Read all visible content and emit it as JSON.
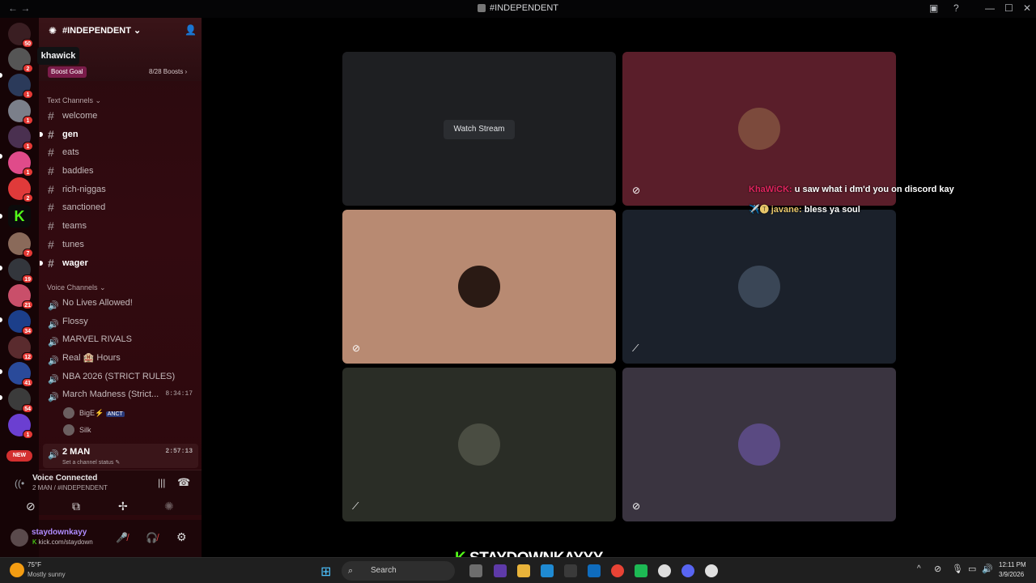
{
  "titlebar": {
    "title": "#INDEPENDENT"
  },
  "servers": {
    "badges": [
      "50",
      "2",
      "1",
      "1",
      "1",
      "1",
      "2",
      "",
      "7",
      "19",
      "21",
      "34",
      "12",
      "41",
      "54",
      "1"
    ],
    "new_label": "NEW",
    "tooltip": "khawick"
  },
  "sidebar": {
    "server_name": "#INDEPENDENT",
    "boost_goal": "Boost Goal",
    "boosts": "8/28 Boosts",
    "text_category": "Text Channels",
    "text_channels": [
      "welcome",
      "gen",
      "eats",
      "baddies",
      "rich-niggas",
      "sanctioned",
      "teams",
      "tunes",
      "wager"
    ],
    "voice_category": "Voice Channels",
    "voice_channels": [
      "No Lives Allowed!",
      "Flossy",
      "MARVEL RIVALS",
      "Real 🏨 Hours",
      "NBA 2026 (STRICT RULES)",
      "March Madness (Strict...",
      "2 MAN"
    ],
    "march_timer": "8:34:17",
    "voice_users": [
      "BigE⚡",
      "ANCT",
      "Silk"
    ],
    "two_man_timer": "2:57:13",
    "channel_status": "Set a channel status",
    "voice_connected": "Voice Connected",
    "voice_location": "2 MAN / #INDEPENDENT",
    "username": "staydownkayy",
    "user_status": "kick.com/staydown"
  },
  "main": {
    "watch_stream": "Watch Stream",
    "chat": [
      {
        "user": "KhaWiCK:",
        "text": "u saw what i dm'd you on discord kay",
        "color": "#e0245e"
      },
      {
        "user": "✈️🅣 javane:",
        "text": "bless ya soul",
        "color": "#e8c76a"
      }
    ]
  },
  "overlay": {
    "watermark": "STAYDOWNKAYYY"
  },
  "taskbar": {
    "temp": "75°F",
    "weather": "Mostly sunny",
    "search": "Search",
    "time": "12:11 PM",
    "date": "3/9/2026"
  }
}
